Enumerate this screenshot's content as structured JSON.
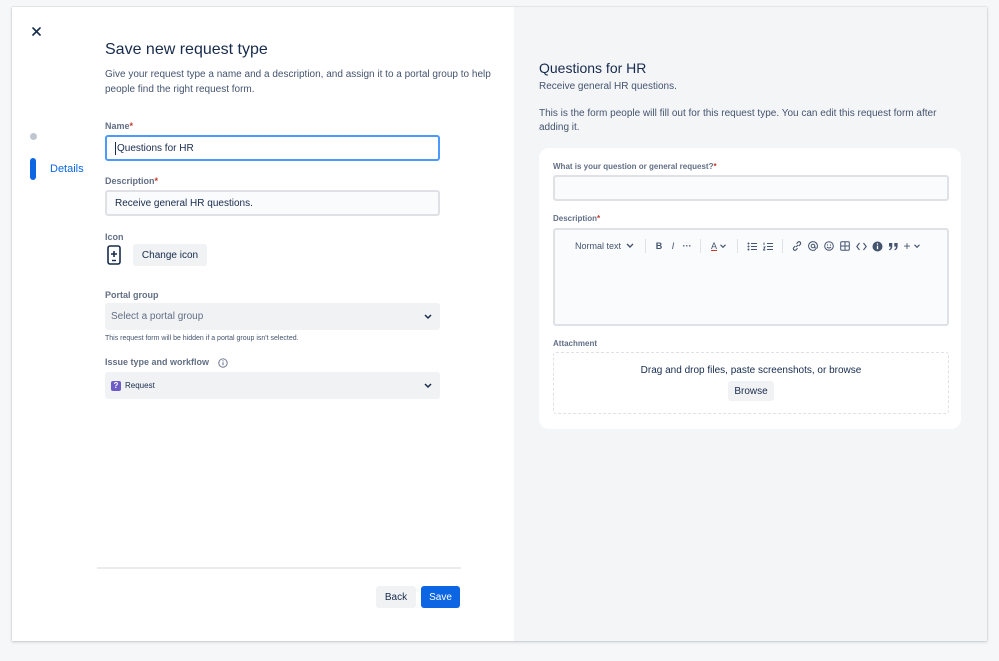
{
  "dialog": {
    "close_label": "×"
  },
  "steps": {
    "current_label": "Details"
  },
  "form": {
    "title": "Save new request type",
    "description": "Give your request type a name and a description, and assign it to a portal group to help people find the right request form.",
    "name_label": "Name",
    "name_value": "Questions for HR",
    "description_label": "Description",
    "description_value": "Receive general HR questions.",
    "icon_label": "Icon",
    "change_icon_label": "Change icon",
    "portal_group_label": "Portal group",
    "portal_group_placeholder": "Select a portal group",
    "portal_group_helper": "This request form will be hidden if a portal group isn't selected.",
    "issue_type_label": "Issue type and workflow",
    "issue_type_value": "Request",
    "required_marker": "*"
  },
  "footer": {
    "back_label": "Back",
    "save_label": "Save"
  },
  "preview": {
    "title": "Questions for HR",
    "subtitle": "Receive general HR questions.",
    "note": "This is the form people will fill out for this request type. You can edit this request form after adding it.",
    "question_label": "What is your question or general request?",
    "description_label": "Description",
    "editor": {
      "text_style": "Normal text",
      "bold": "B",
      "italic": "I",
      "more": "···",
      "text_color": "A",
      "insert": "+"
    },
    "attachment_label": "Attachment",
    "dropzone_text": "Drag and drop files, paste screenshots, or browse",
    "browse_label": "Browse"
  },
  "colors": {
    "primary": "#0c66e4",
    "required": "#c9372c",
    "request_badge": "#6e5dc6",
    "preview_bg": "#f4f5f7"
  }
}
